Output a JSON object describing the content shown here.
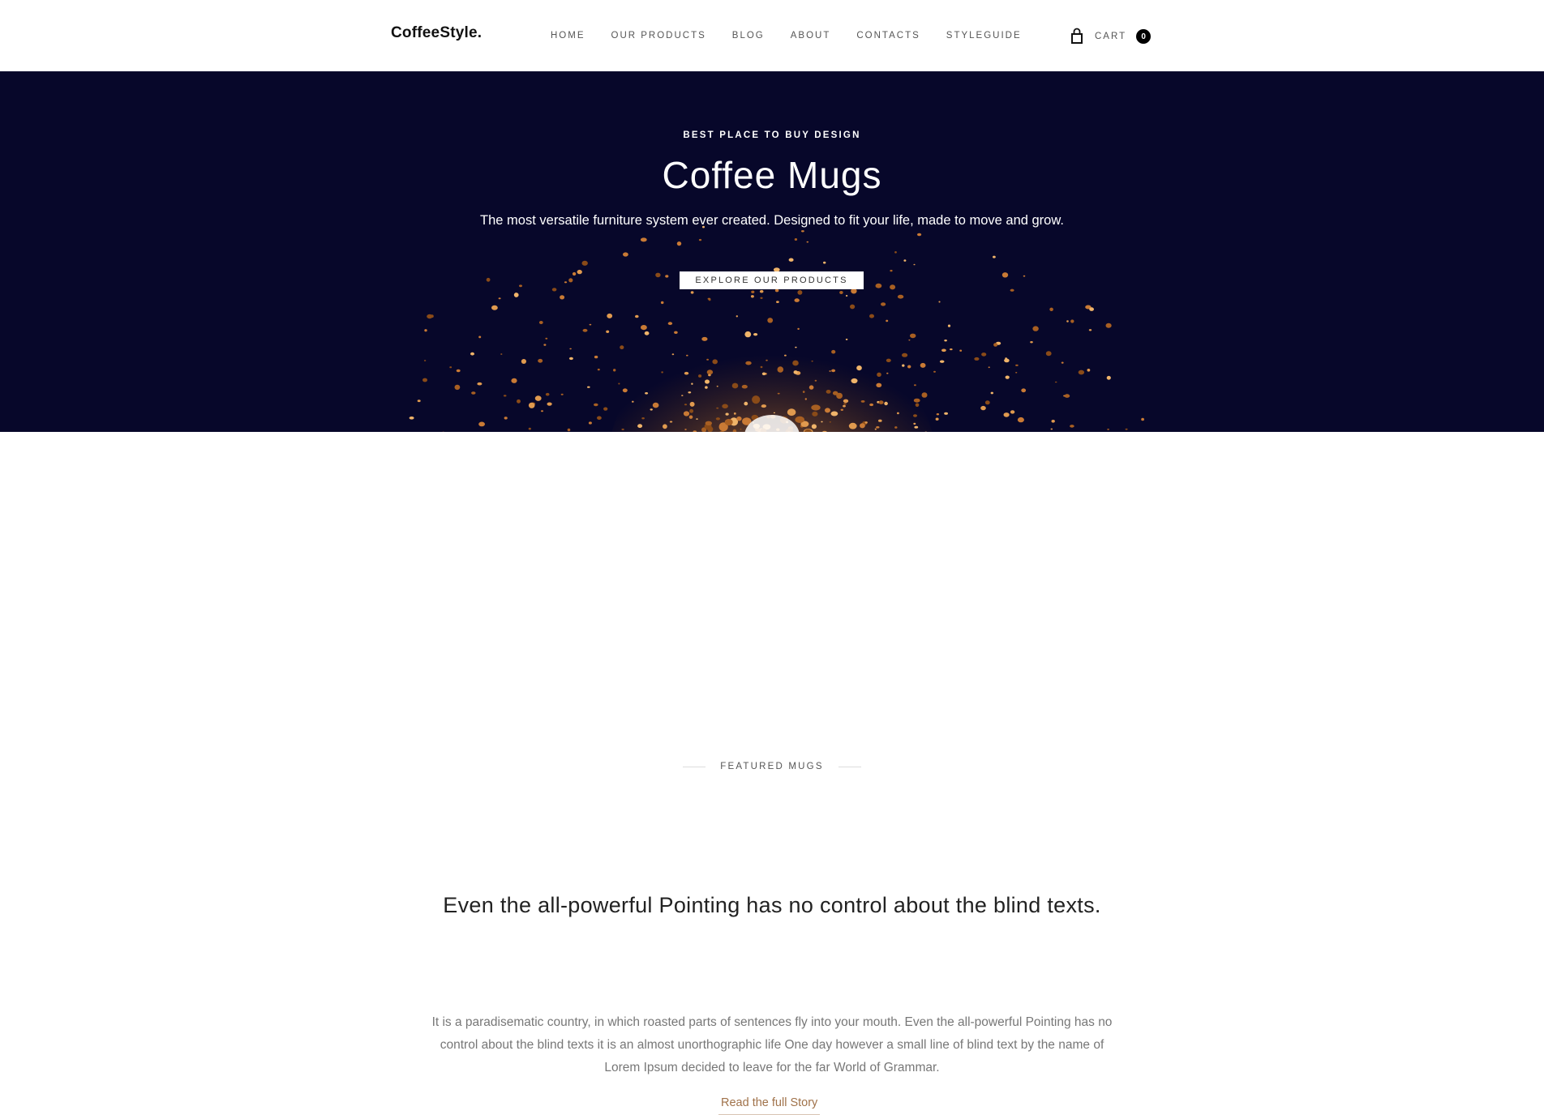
{
  "header": {
    "logo": "CoffeeStyle.",
    "nav": [
      {
        "label": "HOME"
      },
      {
        "label": "OUR PRODUCTS"
      },
      {
        "label": "BLOG"
      },
      {
        "label": "ABOUT"
      },
      {
        "label": "CONTACTS"
      },
      {
        "label": "STYLEGUIDE"
      }
    ],
    "cart": {
      "label": "CART",
      "count": "0",
      "icon": "shopping-bag-icon"
    }
  },
  "hero": {
    "eyebrow": "BEST PLACE TO BUY DESIGN",
    "title": "Coffee Mugs",
    "subtitle": "The most versatile furniture system ever created. Designed to fit your life, made to move and grow.",
    "button": "EXPLORE OUR PRODUCTS",
    "background_color": "#07072a",
    "accent_color": "#c97a35"
  },
  "intro": {
    "title": "Even the all-powerful Pointing has no control about the blind texts.",
    "body": "It is a paradisematic country, in which roasted parts of sentences fly into your mouth. Even the all-powerful Pointing has no control about the blind texts it is an almost unorthographic life One day however a small line of blind text by the name of Lorem Ipsum decided to leave for the far World of Grammar.",
    "link": "Read the full Story",
    "link_color": "#a0724a"
  },
  "featured": {
    "label": "FEATURED MUGS"
  }
}
